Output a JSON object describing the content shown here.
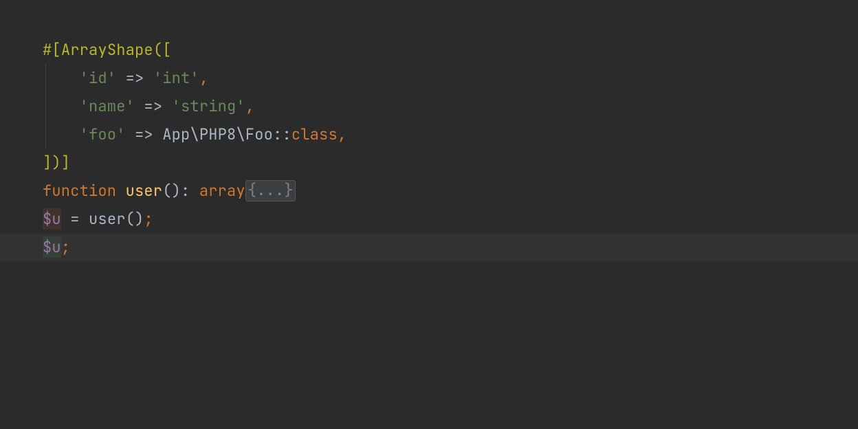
{
  "code": {
    "line1": {
      "attr_open": "#[",
      "attr_name": "ArrayShape",
      "paren_bracket": "(["
    },
    "line2": {
      "key": "'id'",
      "arrow": " => ",
      "value": "'int'",
      "comma": ","
    },
    "line3": {
      "key": "'name'",
      "arrow": " => ",
      "value": "'string'",
      "comma": ","
    },
    "line4": {
      "key": "'foo'",
      "arrow": " => ",
      "class_path": "App\\PHP8\\Foo",
      "double_colon": "::",
      "class_kw": "class",
      "comma": ","
    },
    "line5": {
      "close": "])]"
    },
    "line6": {
      "kw": "function ",
      "fn": "user",
      "sig1": "(): ",
      "ret_kw": "array",
      "fold": "{...}"
    },
    "line7": {
      "blank": ""
    },
    "line8": {
      "dollar": "$",
      "var": "u",
      "eq": " = ",
      "call_fn": "user",
      "call_paren": "()",
      "semi": ";"
    },
    "line9": {
      "dollar": "$",
      "var": "u",
      "semi": ";"
    }
  }
}
